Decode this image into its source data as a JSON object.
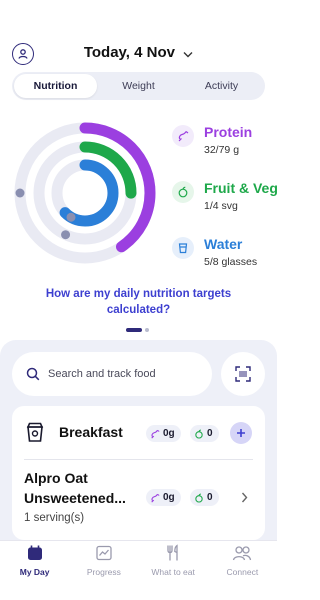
{
  "header": {
    "date_title": "Today, 4 Nov",
    "profile_icon": "profile-icon",
    "dropdown_icon": "chevron-down-icon"
  },
  "tabs": [
    {
      "label": "Nutrition",
      "active": true
    },
    {
      "label": "Weight",
      "active": false
    },
    {
      "label": "Activity",
      "active": false
    }
  ],
  "nutrition": [
    {
      "name": "Protein",
      "value": "32/79 g",
      "color": "#9b3fe0",
      "icon": "protein-icon",
      "progress": 0.405
    },
    {
      "name": "Fruit & Veg",
      "value": "1/4 svg",
      "color": "#1ea84a",
      "icon": "apple-icon",
      "progress": 0.25
    },
    {
      "name": "Water",
      "value": "5/8 glasses",
      "color": "#2b7fd8",
      "icon": "glass-icon",
      "progress": 0.625
    }
  ],
  "help_link": "How are my daily nutrition targets calculated?",
  "search": {
    "placeholder": "Search and track food"
  },
  "meal": {
    "title": "Breakfast",
    "protein": "0g",
    "fruitveg": "0",
    "food": {
      "name": "Alpro Oat Unsweetened...",
      "serving": "1 serving(s)",
      "protein": "0g",
      "fruitveg": "0"
    }
  },
  "bottom_nav": [
    {
      "label": "My Day",
      "active": true,
      "icon": "calendar-icon"
    },
    {
      "label": "Progress",
      "active": false,
      "icon": "chart-icon"
    },
    {
      "label": "What to eat",
      "active": false,
      "icon": "utensils-icon"
    },
    {
      "label": "Connect",
      "active": false,
      "icon": "people-icon"
    }
  ],
  "colors": {
    "accent": "#3d3fd0",
    "dark": "#2f2a7a",
    "track": "#e9eaf3"
  }
}
